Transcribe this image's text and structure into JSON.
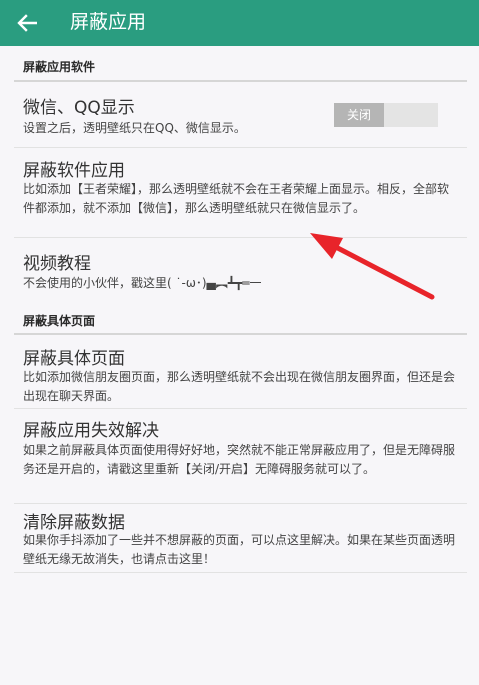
{
  "appbar": {
    "title": "屏蔽应用",
    "back_icon": "arrow-left-icon",
    "color": "#2a9d80"
  },
  "sections": {
    "apps_header": "屏蔽应用软件",
    "page_header": "屏蔽具体页面"
  },
  "items": {
    "wechat_qq": {
      "title": "微信、QQ显示",
      "desc": "设置之后，透明壁纸只在QQ、微信显示。",
      "toggle_label": "关闭",
      "toggle_on": false
    },
    "block_apps": {
      "title": "屏蔽软件应用",
      "desc": "比如添加【王者荣耀】，那么透明壁纸就不会在王者荣耀上面显示。相反，全部软件都添加，就不添加【微信】，那么透明壁纸就只在微信显示了。"
    },
    "video_tutorial": {
      "title": "视频教程",
      "desc": "不会使用的小伙伴，戳这里( ˙-ω･)▄︻┻┳═一"
    },
    "block_page": {
      "title": "屏蔽具体页面",
      "desc": "比如添加微信朋友圈页面，那么透明壁纸就不会出现在微信朋友圈界面，但还是会出现在聊天界面。"
    },
    "block_fail": {
      "title": "屏蔽应用失效解决",
      "desc": "如果之前屏蔽具体页面使用得好好地，突然就不能正常屏蔽应用了，但是无障碍服务还是开启的，请戳这里重新【关闭/开启】无障碍服务就可以了。"
    },
    "clear_data": {
      "title": "清除屏蔽数据",
      "desc": "如果你手抖添加了一些并不想屏蔽的页面，可以点这里解决。如果在某些页面透明壁纸无缘无故消失，也请点击这里！"
    }
  },
  "annotation": {
    "arrow_color": "#e8242a"
  }
}
